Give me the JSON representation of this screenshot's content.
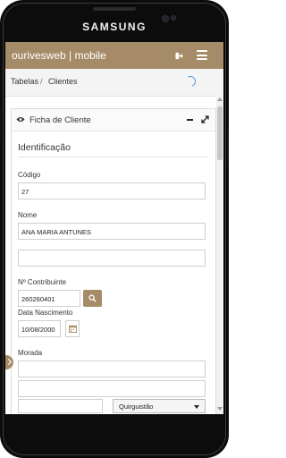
{
  "device": {
    "brand": "SAMSUNG"
  },
  "app": {
    "title": "ourivesweb | mobile"
  },
  "icons": {
    "logout": "logout-icon",
    "menu": "hamburger-menu-icon",
    "view": "eye-icon",
    "minimize": "minus-icon",
    "expand": "expand-icon",
    "search": "search-icon",
    "calendar": "calendar-icon",
    "loading": "loading-spinner-icon"
  },
  "colors": {
    "accent": "#a68b68",
    "spinner": "#4a90d9"
  },
  "breadcrumb": {
    "items": [
      "Tabelas",
      "Clientes"
    ],
    "separator": "/"
  },
  "panel": {
    "title": "Ficha de Cliente",
    "section_title": "Identificação"
  },
  "form": {
    "codigo": {
      "label": "Código",
      "value": "27"
    },
    "nome": {
      "label": "Nome",
      "value": "ANA MARIA ANTUNES",
      "value2": ""
    },
    "contribuinte": {
      "label": "Nº Contribuinte",
      "value": "260260401"
    },
    "nascimento": {
      "label": "Data Nascimento",
      "value": "10/08/2000"
    },
    "morada": {
      "label": "Morada",
      "line1": "",
      "line2": ""
    },
    "localidade": {
      "selected": "Quirguistão"
    }
  }
}
